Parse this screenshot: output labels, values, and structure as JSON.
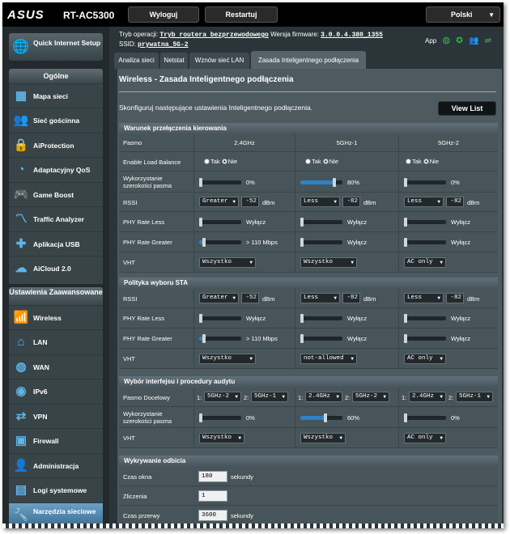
{
  "header": {
    "logo": "ASUS",
    "model": "RT-AC5300",
    "logout": "Wyloguj",
    "restart": "Restartuj",
    "language": "Polski"
  },
  "info": {
    "mode_label": "Tryb operacji:",
    "mode_value": "Tryb routera bezprzewodowego",
    "fw_label": "Wersja firmware:",
    "fw_value": "3.0.0.4.380_1355",
    "ssid_label": "SSID:",
    "ssid_value": "prywatna_5G-2",
    "app_label": "App"
  },
  "sidebar": {
    "quick_setup": "Quick Internet Setup",
    "general_title": "Ogólne",
    "general": [
      "Mapa sieci",
      "Sieć gościnna",
      "AiProtection",
      "Adaptacyjny QoS",
      "Game Boost",
      "Traffic Analyzer",
      "Aplikacja USB",
      "AiCloud 2.0"
    ],
    "advanced_title": "Ustawienia Zaawansowane",
    "advanced": [
      "Wireless",
      "LAN",
      "WAN",
      "IPv6",
      "VPN",
      "Firewall",
      "Administracja",
      "Logi systemowe",
      "Narzędzia sieciowe"
    ]
  },
  "tabs": [
    "Analiza sieci",
    "Netstat",
    "Wznów sieć LAN",
    "Zasada Inteligentnego podłączenia"
  ],
  "page": {
    "title": "Wireless - Zasada Inteligentnego podłączenia",
    "description": "Skonfiguruj następujące ustawienia Inteligentnego podłączenia.",
    "view_list": "View List"
  },
  "steering": {
    "section": "Warunek przełączenia kierowania",
    "band_label": "Pasmo",
    "bands": [
      "2.4GHz",
      "5GHz-1",
      "5GHz-2"
    ],
    "load_balance_label": "Enable Load Balance",
    "yes": "Tak",
    "no": "Nie",
    "bw_label": "Wykorzystanie szerokości pasma",
    "bw_text": [
      "0%",
      "80%",
      "0%"
    ],
    "bw_values": [
      0,
      80,
      0
    ],
    "rssi_label": "RSSI",
    "rssi": [
      {
        "cond": "Greater",
        "value": "-52"
      },
      {
        "cond": "Less",
        "value": "-82"
      },
      {
        "cond": "Less",
        "value": "-82"
      }
    ],
    "dbm": "dBm",
    "phy_less_label": "PHY Rate Less",
    "phy_less": [
      "Wyłącz",
      "Wyłącz",
      "Wyłącz"
    ],
    "phy_greater_label": "PHY Rate Greater",
    "phy_greater": [
      "> 110 Mbps",
      "Wyłącz",
      "Wyłącz"
    ],
    "vht_label": "VHT",
    "vht": [
      "Wszystko",
      "Wszystko",
      "AC only"
    ]
  },
  "sta": {
    "section": "Polityka wyboru STA",
    "rssi_label": "RSSI",
    "rssi": [
      {
        "cond": "Greater",
        "value": "-52"
      },
      {
        "cond": "Less",
        "value": "-82"
      },
      {
        "cond": "Less",
        "value": "-82"
      }
    ],
    "phy_less_label": "PHY Rate Less",
    "phy_less": [
      "Wyłącz",
      "Wyłącz",
      "Wyłącz"
    ],
    "phy_greater_label": "PHY Rate Greater",
    "phy_greater": [
      "> 110 Mbps",
      "Wyłącz",
      "Wyłącz"
    ],
    "vht_label": "VHT",
    "vht": [
      "Wszystko",
      "not-allowed",
      "AC only"
    ]
  },
  "iface": {
    "section": "Wybór interfejsu i procedury audytu",
    "target_label": "Pasmo Docelowy",
    "targets": [
      [
        "5GHz-2",
        "5GHz-1"
      ],
      [
        "2.4GHz",
        "5GHz-2"
      ],
      [
        "2.4GHz",
        "5GHz-1"
      ]
    ],
    "bw_label": "Wykorzystanie szerokości pasma",
    "bw_text": [
      "0%",
      "60%",
      "0%"
    ],
    "bw_values": [
      0,
      60,
      0
    ],
    "vht_label": "VHT",
    "vht": [
      "Wszystko",
      "Wszystko",
      "AC only"
    ]
  },
  "bounce": {
    "section": "Wykrywanie odbicia",
    "window_label": "Czas okna",
    "window_value": "180",
    "count_label": "Zliczenia",
    "count_value": "1",
    "dwell_label": "Czas przerwy",
    "dwell_value": "3600",
    "seconds": "sekundy"
  },
  "colors": {
    "accent": "#2e82c8",
    "active_nav": "#4f86ad",
    "panel": "#4d5a60"
  }
}
